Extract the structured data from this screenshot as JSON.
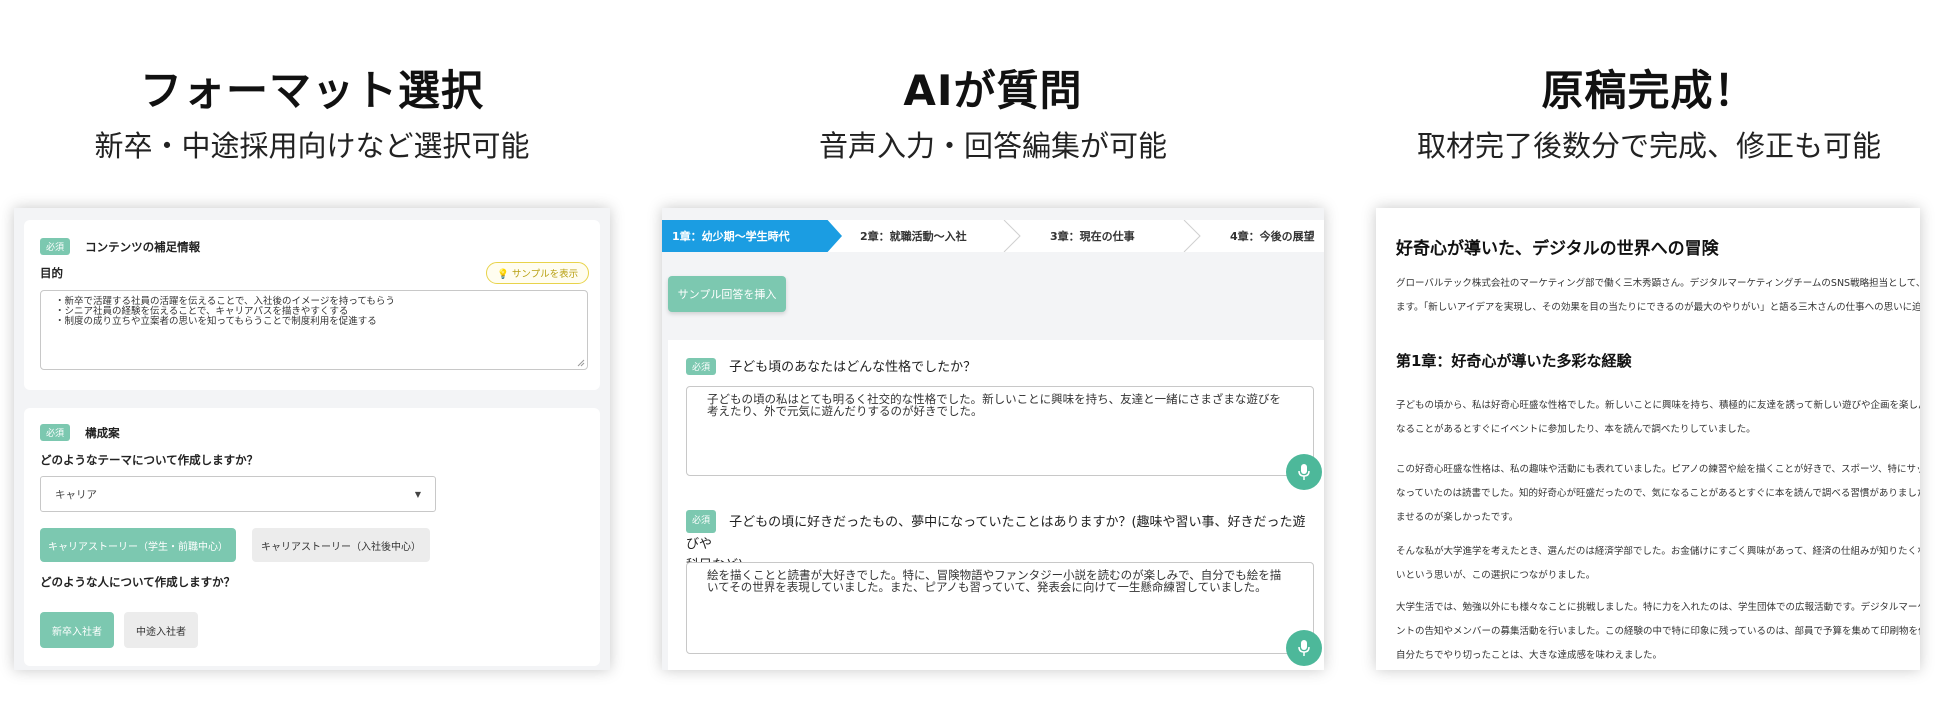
{
  "columns": [
    {
      "title": "フォーマット選択",
      "subtitle": "新卒・中途採用向けなど選択可能"
    },
    {
      "title": "AIが質問",
      "subtitle": "音声入力・回答編集が可能"
    },
    {
      "title": "原稿完成！",
      "subtitle": "取材完了後数分で完成、修正も可能"
    }
  ],
  "panel1": {
    "required_badge": "必須",
    "card1_title": "コンテンツの補足情報",
    "purpose_label": "目的",
    "sample_button": "サンプルを表示",
    "purpose_lines": [
      "・新卒で活躍する社員の活躍を伝えることで、入社後のイメージを持ってもらう",
      "・シニア社員の経験を伝えることで、キャリアパスを描きやすくする",
      "・制度の成り立ちや立案者の思いを知ってもらうことで制度利用を促進する"
    ],
    "card2_title": "構成案",
    "theme_question": "どのようなテーマについて作成しますか？",
    "theme_select": "キャリア",
    "theme_options": [
      "キャリアストーリー（学生・前職中心）",
      "キャリアストーリー（入社後中心）"
    ],
    "person_question": "どのような人について作成しますか？",
    "person_options": [
      "新卒入社者",
      "中途入社者"
    ]
  },
  "panel2": {
    "steps": [
      "1章：幼少期〜学生時代",
      "2章：就職活動〜入社",
      "3章：現在の仕事",
      "4章：今後の展望"
    ],
    "insert_button": "サンプル回答を挿入",
    "required_badge": "必須",
    "q1": "子ども頃のあなたはどんな性格でしたか？",
    "a1_lines": [
      "子どもの頃の私はとても明るく社交的な性格でした。新しいことに興味を持ち、友達と一緒にさまざまな遊びを",
      "考えたり、外で元気に遊んだりするのが好きでした。"
    ],
    "q2_line1": "子どもの頃に好きだったもの、夢中になっていたことはありますか？(趣味や習い事、好きだった遊びや",
    "q2_line2": "科目など)",
    "a2_lines": [
      "絵を描くことと読書が大好きでした。特に、冒険物語やファンタジー小説を読むのが楽しみで、自分でも絵を描",
      "いてその世界を表現していました。また、ピアノも習っていて、発表会に向けて一生懸命練習していました。"
    ]
  },
  "panel3": {
    "title": "好奇心が導いた、デジタルの世界への冒険",
    "intro_lines": [
      "グローバルテック株式会社のマーケティング部で働く三木秀顕さん。デジタルマーケティングチームのSNS戦略担当として、フ",
      "ます。「新しいアイデアを実現し、その効果を目の当たりにできるのが最大のやりがい」と語る三木さんの仕事への思いに迫りま"
    ],
    "chapter1": "第1章：好奇心が導いた多彩な経験",
    "para1": [
      "子どもの頃から、私は好奇心旺盛な性格でした。新しいことに興味を持ち、積極的に友達を誘って新しい遊びや企画を楽しん",
      "なることがあるとすぐにイベントに参加したり、本を読んで調べたりしていました。"
    ],
    "para2": [
      "この好奇心旺盛な性格は、私の趣味や活動にも表れていました。ピアノの練習や絵を描くことが好きで、スポーツ、特にサッカー",
      "なっていたのは読書でした。知的好奇心が旺盛だったので、気になることがあるとすぐに本を読んで調べる習慣がありました。",
      "ませるのが楽しかったです。"
    ],
    "para3": [
      "そんな私が大学進学を考えたとき、選んだのは経済学部でした。お金儲けにすごく興味があって、経済の仕組みが知りたくな",
      "いという思いが、この選択につながりました。"
    ],
    "para4": [
      "大学生活では、勉強以外にも様々なことに挑戦しました。特に力を入れたのは、学生団体での広報活動です。デジタルマーケテ",
      "ントの告知やメンバーの募集活動を行いました。この経験の中で特に印象に残っているのは、部員で予算を集めて印刷物を作",
      "自分たちでやり切ったことは、大きな達成感を味わえました。"
    ]
  },
  "colors": {
    "accent_green": "#7cc8b0",
    "step_blue": "#1b9de2",
    "mic_green": "#4db89a",
    "sample_yellow": "#e8d34a"
  }
}
